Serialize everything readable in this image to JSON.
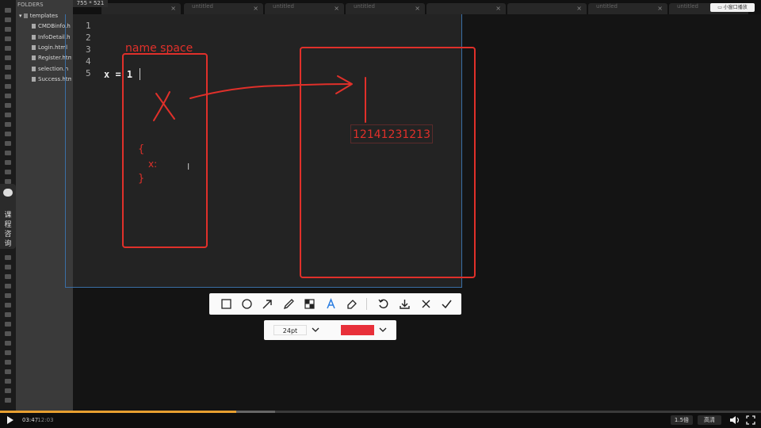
{
  "overlay": {
    "size_badge": "755 * 521",
    "mini_window": "小窗口播放"
  },
  "sidebar": {
    "folders_label": "FOLDERS",
    "folder": "templates",
    "files": [
      "CMDBinfo.h",
      "InfoDetail.h",
      "Login.html",
      "Register.html",
      "selection.h",
      "Success.html"
    ]
  },
  "tabs": [
    {
      "label": ""
    },
    {
      "label": "untitled"
    },
    {
      "label": "untitled"
    },
    {
      "label": "untitled"
    },
    {
      "label": ""
    },
    {
      "label": ""
    },
    {
      "label": "untitled"
    },
    {
      "label": "untitled"
    }
  ],
  "editor": {
    "line_numbers": [
      "1",
      "2",
      "3",
      "4",
      "5"
    ],
    "code_line": "x = 1"
  },
  "annotations": {
    "namespace_label": "name space",
    "variable_letter": "X",
    "brace_open": "{",
    "dict_key": "x:",
    "brace_close": "}",
    "object_value": "12141231213"
  },
  "toolbar": {
    "tools": [
      "rectangle-tool-icon",
      "circle-tool-icon",
      "arrow-tool-icon",
      "pen-tool-icon",
      "mosaic-tool-icon",
      "text-tool-icon",
      "eraser-tool-icon",
      "undo-icon",
      "download-icon",
      "close-icon",
      "check-icon"
    ],
    "font_size": "24pt",
    "color": "#e8303a"
  },
  "consult": {
    "label": "课程咨询"
  },
  "player": {
    "current_time": "03:47",
    "total_time": "/12:03",
    "progress": 0.31,
    "speed": "1.5倍",
    "quality": "高清"
  },
  "colors": {
    "annotation_red": "#e0302a",
    "selection_blue": "#3a6ea5",
    "progress_orange": "#e8a030"
  }
}
